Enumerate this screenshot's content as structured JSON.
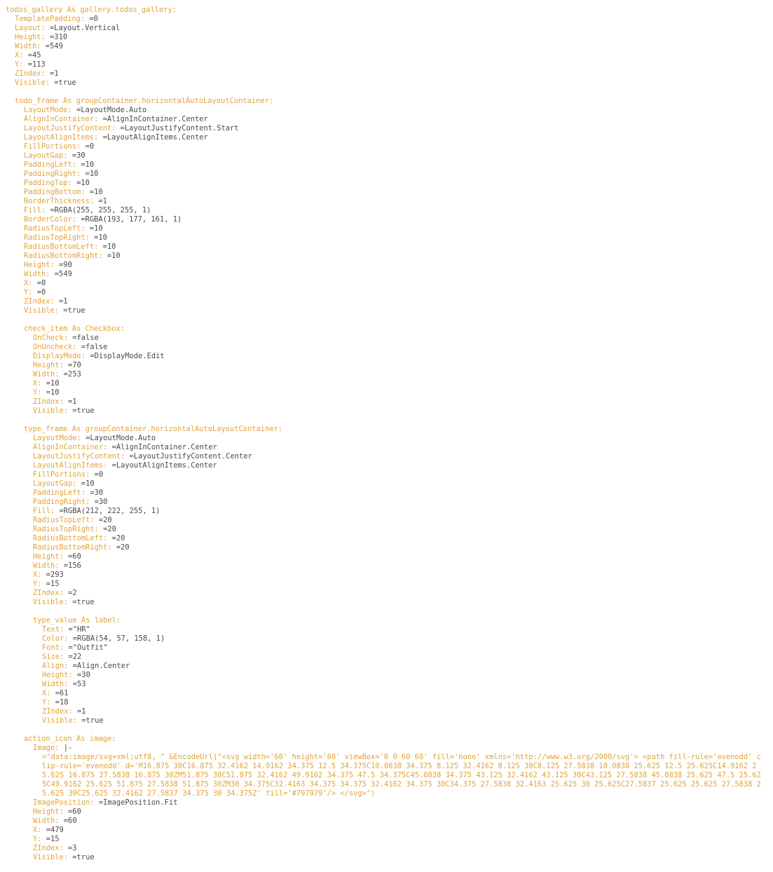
{
  "colors": {
    "key": "#e3a33a",
    "value": "#4a4a4a",
    "background": "#ffffff"
  },
  "lines": [
    {
      "indent": 0,
      "key": "todos_gallery As gallery.todos_gallery:",
      "value": ""
    },
    {
      "indent": 1,
      "key": "TemplatePadding:",
      "value": " =0"
    },
    {
      "indent": 1,
      "key": "Layout:",
      "value": " =Layout.Vertical"
    },
    {
      "indent": 1,
      "key": "Height:",
      "value": " =310"
    },
    {
      "indent": 1,
      "key": "Width:",
      "value": " =549"
    },
    {
      "indent": 1,
      "key": "X:",
      "value": " =45"
    },
    {
      "indent": 1,
      "key": "Y:",
      "value": " =113"
    },
    {
      "indent": 1,
      "key": "ZIndex:",
      "value": " =1"
    },
    {
      "indent": 1,
      "key": "Visible:",
      "value": " =true"
    },
    {
      "blank": true
    },
    {
      "indent": 1,
      "key": "todo_frame As groupContainer.horizontalAutoLayoutContainer:",
      "value": ""
    },
    {
      "indent": 2,
      "key": "LayoutMode:",
      "value": " =LayoutMode.Auto"
    },
    {
      "indent": 2,
      "key": "AlignInContainer:",
      "value": " =AlignInContainer.Center"
    },
    {
      "indent": 2,
      "key": "LayoutJustifyContent:",
      "value": " =LayoutJustifyContent.Start"
    },
    {
      "indent": 2,
      "key": "LayoutAlignItems:",
      "value": " =LayoutAlignItems.Center"
    },
    {
      "indent": 2,
      "key": "FillPortions:",
      "value": " =0"
    },
    {
      "indent": 2,
      "key": "LayoutGap:",
      "value": " =30"
    },
    {
      "indent": 2,
      "key": "PaddingLeft:",
      "value": " =10"
    },
    {
      "indent": 2,
      "key": "PaddingRight:",
      "value": " =10"
    },
    {
      "indent": 2,
      "key": "PaddingTop:",
      "value": " =10"
    },
    {
      "indent": 2,
      "key": "PaddingBottom:",
      "value": " =10"
    },
    {
      "indent": 2,
      "key": "BorderThickness:",
      "value": " =1"
    },
    {
      "indent": 2,
      "key": "Fill:",
      "value": " =RGBA(255, 255, 255, 1)"
    },
    {
      "indent": 2,
      "key": "BorderColor:",
      "value": " =RGBA(193, 177, 161, 1)"
    },
    {
      "indent": 2,
      "key": "RadiusTopLeft:",
      "value": " =10"
    },
    {
      "indent": 2,
      "key": "RadiusTopRight:",
      "value": " =10"
    },
    {
      "indent": 2,
      "key": "RadiusBottomLeft:",
      "value": " =10"
    },
    {
      "indent": 2,
      "key": "RadiusBottomRight:",
      "value": " =10"
    },
    {
      "indent": 2,
      "key": "Height:",
      "value": " =90"
    },
    {
      "indent": 2,
      "key": "Width:",
      "value": " =549"
    },
    {
      "indent": 2,
      "key": "X:",
      "value": " =0"
    },
    {
      "indent": 2,
      "key": "Y:",
      "value": " =0"
    },
    {
      "indent": 2,
      "key": "ZIndex:",
      "value": " =1"
    },
    {
      "indent": 2,
      "key": "Visible:",
      "value": " =true"
    },
    {
      "blank": true
    },
    {
      "indent": 2,
      "key": "check_item As Checkbox:",
      "value": ""
    },
    {
      "indent": 3,
      "key": "OnCheck:",
      "value": " =false"
    },
    {
      "indent": 3,
      "key": "OnUncheck:",
      "value": " =false"
    },
    {
      "indent": 3,
      "key": "DisplayMode:",
      "value": " =DisplayMode.Edit"
    },
    {
      "indent": 3,
      "key": "Height:",
      "value": " =70"
    },
    {
      "indent": 3,
      "key": "Width:",
      "value": " =253"
    },
    {
      "indent": 3,
      "key": "X:",
      "value": " =10"
    },
    {
      "indent": 3,
      "key": "Y:",
      "value": " =10"
    },
    {
      "indent": 3,
      "key": "ZIndex:",
      "value": " =1"
    },
    {
      "indent": 3,
      "key": "Visible:",
      "value": " =true"
    },
    {
      "blank": true
    },
    {
      "indent": 2,
      "key": "type_frame As groupContainer.horizontalAutoLayoutContainer:",
      "value": ""
    },
    {
      "indent": 3,
      "key": "LayoutMode:",
      "value": " =LayoutMode.Auto"
    },
    {
      "indent": 3,
      "key": "AlignInContainer:",
      "value": " =AlignInContainer.Center"
    },
    {
      "indent": 3,
      "key": "LayoutJustifyContent:",
      "value": " =LayoutJustifyContent.Center"
    },
    {
      "indent": 3,
      "key": "LayoutAlignItems:",
      "value": " =LayoutAlignItems.Center"
    },
    {
      "indent": 3,
      "key": "FillPortions:",
      "value": " =0"
    },
    {
      "indent": 3,
      "key": "LayoutGap:",
      "value": " =10"
    },
    {
      "indent": 3,
      "key": "PaddingLeft:",
      "value": " =30"
    },
    {
      "indent": 3,
      "key": "PaddingRight:",
      "value": " =30"
    },
    {
      "indent": 3,
      "key": "Fill:",
      "value": " =RGBA(212, 222, 255, 1)"
    },
    {
      "indent": 3,
      "key": "RadiusTopLeft:",
      "value": " =20"
    },
    {
      "indent": 3,
      "key": "RadiusTopRight:",
      "value": " =20"
    },
    {
      "indent": 3,
      "key": "RadiusBottomLeft:",
      "value": " =20"
    },
    {
      "indent": 3,
      "key": "RadiusBottomRight:",
      "value": " =20"
    },
    {
      "indent": 3,
      "key": "Height:",
      "value": " =60"
    },
    {
      "indent": 3,
      "key": "Width:",
      "value": " =156"
    },
    {
      "indent": 3,
      "key": "X:",
      "value": " =293"
    },
    {
      "indent": 3,
      "key": "Y:",
      "value": " =15"
    },
    {
      "indent": 3,
      "key": "ZIndex:",
      "value": " =2"
    },
    {
      "indent": 3,
      "key": "Visible:",
      "value": " =true"
    },
    {
      "blank": true
    },
    {
      "indent": 3,
      "key": "type_value As label:",
      "value": ""
    },
    {
      "indent": 4,
      "key": "Text:",
      "value": " =\"HR\""
    },
    {
      "indent": 4,
      "key": "Color:",
      "value": " =RGBA(54, 57, 158, 1)"
    },
    {
      "indent": 4,
      "key": "Font:",
      "value": " =\"Outfit\""
    },
    {
      "indent": 4,
      "key": "Size:",
      "value": " =22"
    },
    {
      "indent": 4,
      "key": "Align:",
      "value": " =Align.Center"
    },
    {
      "indent": 4,
      "key": "Height:",
      "value": " =30"
    },
    {
      "indent": 4,
      "key": "Width:",
      "value": " =53"
    },
    {
      "indent": 4,
      "key": "X:",
      "value": " =61"
    },
    {
      "indent": 4,
      "key": "Y:",
      "value": " =18"
    },
    {
      "indent": 4,
      "key": "ZIndex:",
      "value": " =1"
    },
    {
      "indent": 4,
      "key": "Visible:",
      "value": " =true"
    },
    {
      "blank": true
    },
    {
      "indent": 2,
      "key": "action_icon As image:",
      "value": ""
    },
    {
      "indent": 3,
      "key": "Image:",
      "value": " |-"
    },
    {
      "wrap": true,
      "indent": 4,
      "key": "=\"data:image/svg+xml;utf8, \" &EncodeUrl(\"<svg width='60' height='60' viewBox='0 0 60 60' fill='none' xmlns='http://www.w3.org/2000/svg'> <path fill-rule='evenodd' clip-rule='evenodd' d='M16.875 30C16.875 32.4162 14.9162 34.375 12.5 34.375C10.0838 34.375 8.125 32.4162 8.125 30C8.125 27.5838 10.0838 25.625 12.5 25.625C14.9162 25.625 16.875 27.5838 16.875 30ZM51.875 30C51.875 32.4162 49.9162 34.375 47.5 34.375C45.0838 34.375 43.125 32.4162 43.125 30C43.125 27.5838 45.0838 25.625 47.5 25.625C49.9162 25.625 51.875 27.5838 51.875 30ZM30 34.375C32.4163 34.375 34.375 32.4162 34.375 30C34.375 27.5838 32.4163 25.625 30 25.625C27.5837 25.625 25.625 27.5838 25.625 30C25.625 32.4162 27.5837 34.375 30 34.375Z' fill='#797979'/> </svg>\")",
      "value": ""
    },
    {
      "indent": 3,
      "key": "ImagePosition:",
      "value": " =ImagePosition.Fit"
    },
    {
      "indent": 3,
      "key": "Height:",
      "value": " =60"
    },
    {
      "indent": 3,
      "key": "Width:",
      "value": " =60"
    },
    {
      "indent": 3,
      "key": "X:",
      "value": " =479"
    },
    {
      "indent": 3,
      "key": "Y:",
      "value": " =15"
    },
    {
      "indent": 3,
      "key": "ZIndex:",
      "value": " =3"
    },
    {
      "indent": 3,
      "key": "Visible:",
      "value": " =true"
    }
  ]
}
